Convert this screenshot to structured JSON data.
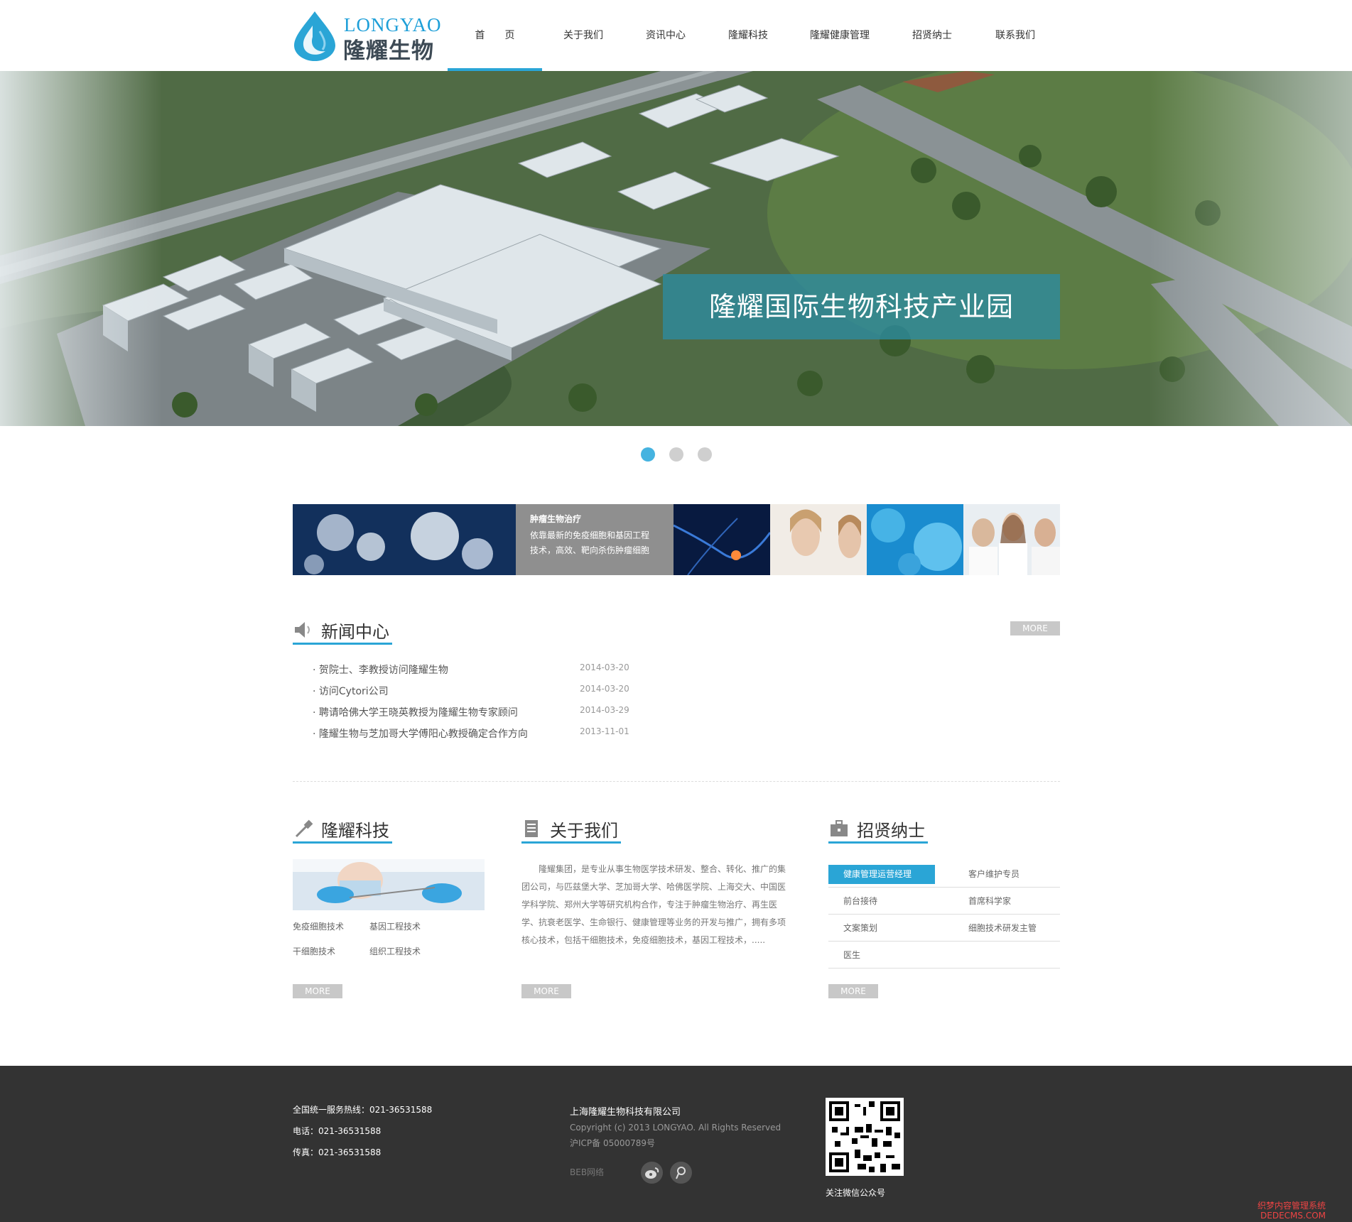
{
  "header": {
    "logo_en": "LONGYAO",
    "logo_cn": "隆耀生物",
    "nav": [
      {
        "label": "首　　页",
        "active": true
      },
      {
        "label": "关于我们"
      },
      {
        "label": "资讯中心"
      },
      {
        "label": "隆耀科技"
      },
      {
        "label": "隆耀健康管理"
      },
      {
        "label": "招贤纳士"
      },
      {
        "label": "联系我们"
      }
    ]
  },
  "banner": {
    "caption": "隆耀国际生物科技产业园",
    "dots": 3,
    "active_dot": 0
  },
  "strip": {
    "title": "肿瘤生物治疗",
    "desc_line1": "依靠最新的免疫细胞和基因工程",
    "desc_line2": "技术，高效、靶向杀伤肿瘤细胞"
  },
  "news": {
    "title": "新闻中心",
    "more": "MORE",
    "items": [
      {
        "title": "· 贺院士、李教授访问隆耀生物",
        "date": "2014-03-20"
      },
      {
        "title": "· 访问Cytori公司",
        "date": "2014-03-20"
      },
      {
        "title": "· 聘请哈佛大学王晓英教授为隆耀生物专家顾问",
        "date": "2014-03-29"
      },
      {
        "title": "· 隆耀生物与芝加哥大学傅阳心教授确定合作方向",
        "date": "2013-11-01"
      }
    ]
  },
  "tech": {
    "title": "隆耀科技",
    "links": [
      "免疫细胞技术",
      "基因工程技术",
      "干细胞技术",
      "组织工程技术"
    ],
    "more": "MORE"
  },
  "about": {
    "title": "关于我们",
    "text": "隆耀集团，是专业从事生物医学技术研发、整合、转化、推广的集团公司，与匹兹堡大学、芝加哥大学、哈佛医学院、上海交大、中国医学科学院、郑州大学等研究机构合作，专注于肿瘤生物治疗、再生医学、抗衰老医学、生命银行、健康管理等业务的开发与推广，拥有多项核心技术，包括干细胞技术，免疫细胞技术，基因工程技术，.....",
    "more": "MORE"
  },
  "jobs": {
    "title": "招贤纳士",
    "rows": [
      [
        "健康管理运营经理",
        "客户维护专员"
      ],
      [
        "前台接待",
        "首席科学家"
      ],
      [
        "文案策划",
        "细胞技术研发主管"
      ],
      [
        "医生",
        ""
      ]
    ],
    "more": "MORE"
  },
  "footer": {
    "hotline": "全国统一服务热线：021-36531588",
    "phone": "电话：021-36531588",
    "fax": "传真：021-36531588",
    "company": "上海隆耀生物科技有限公司",
    "copyright": "Copyright (c) 2013 LONGYAO. All Rights Reserved",
    "icp": "沪ICP备 05000789号",
    "beb": "BEB网络",
    "qr_label": "关注微信公众号",
    "watermark_1": "织梦内容管理系统",
    "watermark_2": "DEDECMS.COM"
  },
  "colors": {
    "accent": "#2aa5d6",
    "footer_bg": "#333333",
    "more_bg": "#c8c8c8"
  }
}
